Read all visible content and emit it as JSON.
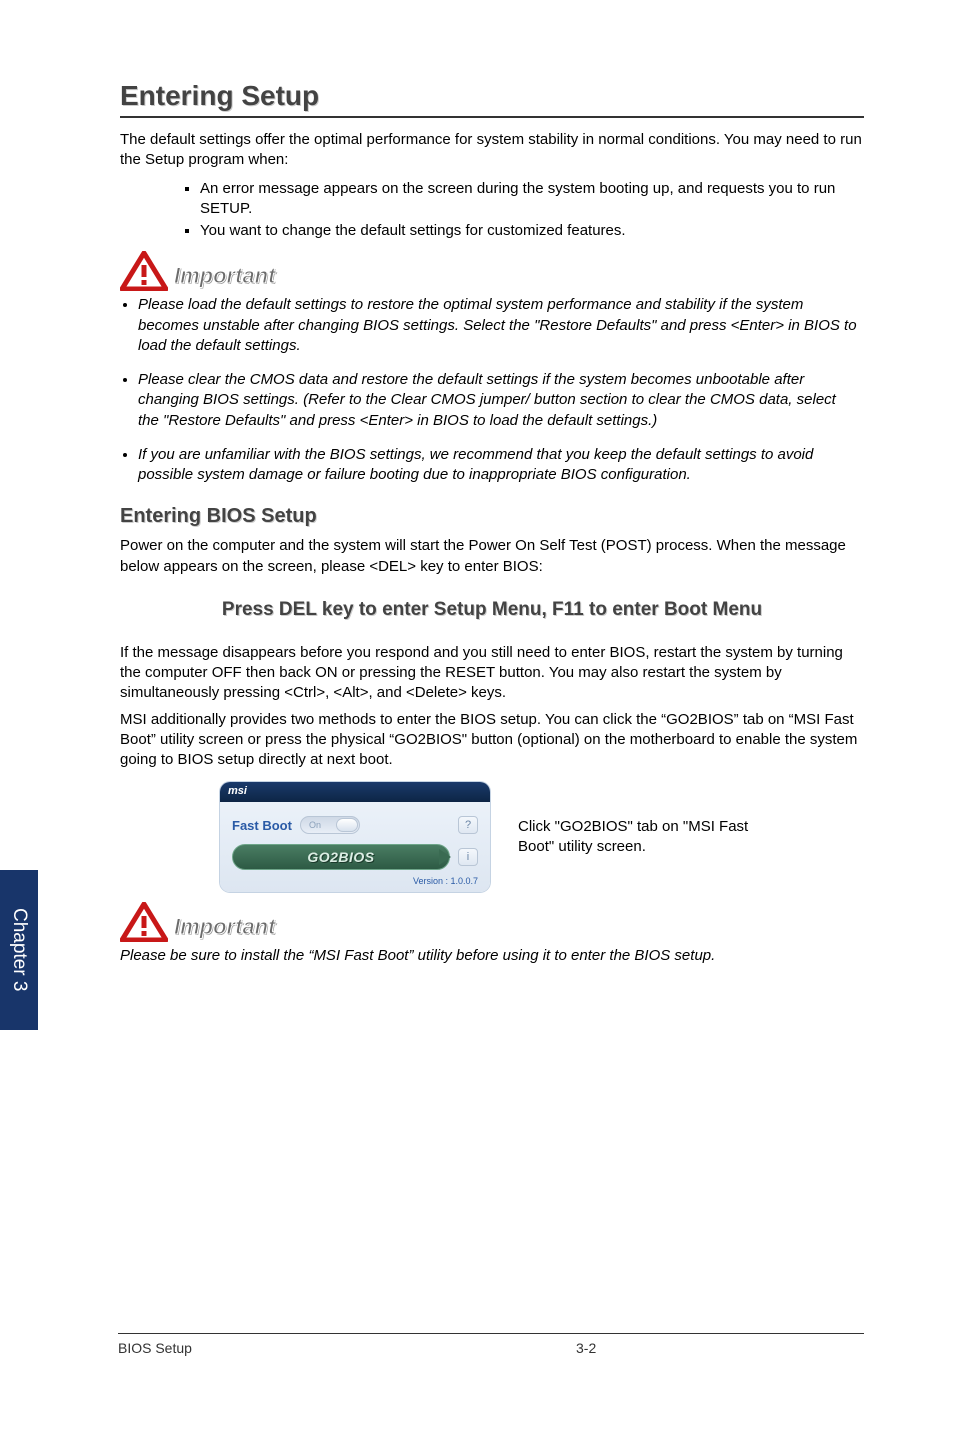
{
  "chapter_tab": "Chapter 3",
  "h1": "Entering Setup",
  "intro": "The default settings offer the optimal performance for system stability in normal conditions. You may need to run the Setup program when:",
  "bullets_main": [
    "An error message appears on the screen during the system booting up, and requests you to run SETUP.",
    "You want to change the default settings for customized features."
  ],
  "important_label": "Important",
  "important_items": [
    "Please load the default settings to restore the optimal system performance and stability if the system becomes unstable after changing BIOS settings. Select the \"Restore Defaults\" and press <Enter> in BIOS to load the default settings.",
    "Please clear the CMOS data and restore the default settings if the system becomes unbootable after changing BIOS settings. (Refer to the Clear CMOS jumper/ button section to clear the CMOS data, select the \"Restore Defaults\" and press <Enter> in BIOS to load the default settings.)",
    "If you are unfamiliar with the BIOS settings, we recommend that you keep the default settings to avoid possible system damage or failure booting due to inappropriate BIOS configuration."
  ],
  "h2": "Entering BIOS Setup",
  "para1": "Power on the computer and the system will start the Power On Self Test (POST) process. When the message below appears on the screen, please <DEL> key to enter BIOS:",
  "press_line": "Press DEL key to enter Setup Menu, F11 to enter Boot Menu",
  "para2": "If the message disappears before you respond and you still need to enter BIOS, restart the system by turning the computer OFF then back ON or pressing the RESET button. You may also restart the system by simultaneously pressing <Ctrl>, <Alt>, and <Delete> keys.",
  "para3": "MSI additionally provides two methods to enter the BIOS setup. You can click the “GO2BIOS” tab on “MSI Fast Boot” utility screen or press the physical “GO2BIOS\" button (optional) on the motherboard to enable the system going to BIOS setup directly at next boot.",
  "fastboot": {
    "brand": "msi",
    "label": "Fast Boot",
    "toggle_state": "On",
    "help": "?",
    "button": "GO2BIOS",
    "info": "i",
    "version_label": "Version : 1.0.0.7"
  },
  "fastboot_desc": "Click \"GO2BIOS\" tab on \"MSI Fast Boot\" utility screen.",
  "important2_note": "Please be sure to install the “MSI Fast Boot” utility before using it to enter the BIOS setup.",
  "footer_left": "BIOS Setup",
  "footer_page": "3-2"
}
